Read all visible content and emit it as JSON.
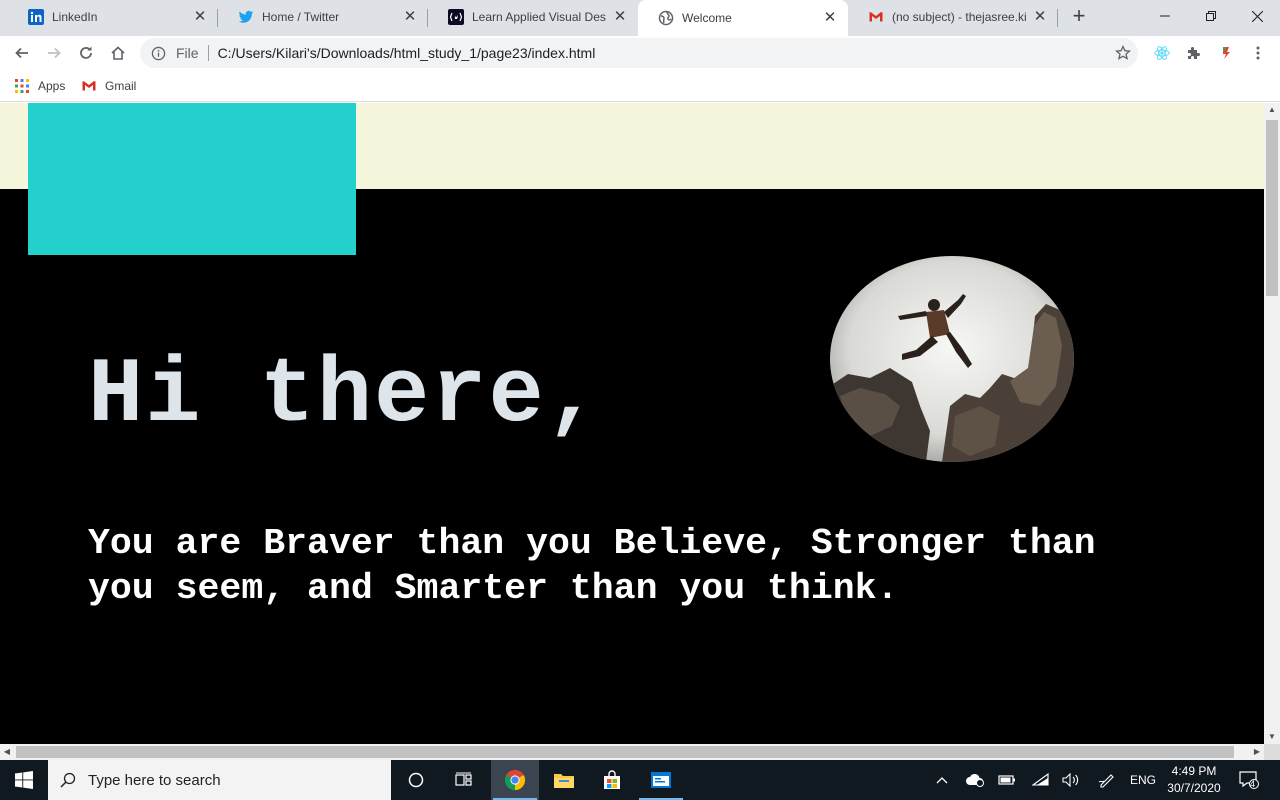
{
  "browser": {
    "tabs": [
      {
        "title": "LinkedIn",
        "icon": "linkedin-icon",
        "active": false
      },
      {
        "title": "Home / Twitter",
        "icon": "twitter-icon",
        "active": false
      },
      {
        "title": "Learn Applied Visual Design",
        "icon": "freecodecamp-icon",
        "active": false
      },
      {
        "title": "Welcome",
        "icon": "globe-icon",
        "active": true
      },
      {
        "title": "(no subject) - thejasree.kilari",
        "icon": "gmail-icon",
        "active": false
      }
    ],
    "address": {
      "scheme_label": "File",
      "url": "C:/Users/Kilari's/Downloads/html_study_1/page23/index.html"
    },
    "bookmarks": [
      {
        "label": "Apps",
        "icon": "apps-grid-icon"
      },
      {
        "label": "Gmail",
        "icon": "gmail-icon"
      }
    ]
  },
  "page": {
    "heading": "Hi there,",
    "quote": "You are Braver than you Believe, Stronger than you seem, and Smarter than you think.",
    "colors": {
      "top_band": "#f5f5dc",
      "accent_box": "#24d0cb",
      "background": "#000000",
      "heading": "#dde4ea",
      "quote": "#ffffff"
    },
    "image": "person-jumping-between-rocks"
  },
  "taskbar": {
    "search_placeholder": "Type here to search",
    "language": "ENG",
    "time": "4:49 PM",
    "date": "30/7/2020",
    "notification_count": "4"
  }
}
